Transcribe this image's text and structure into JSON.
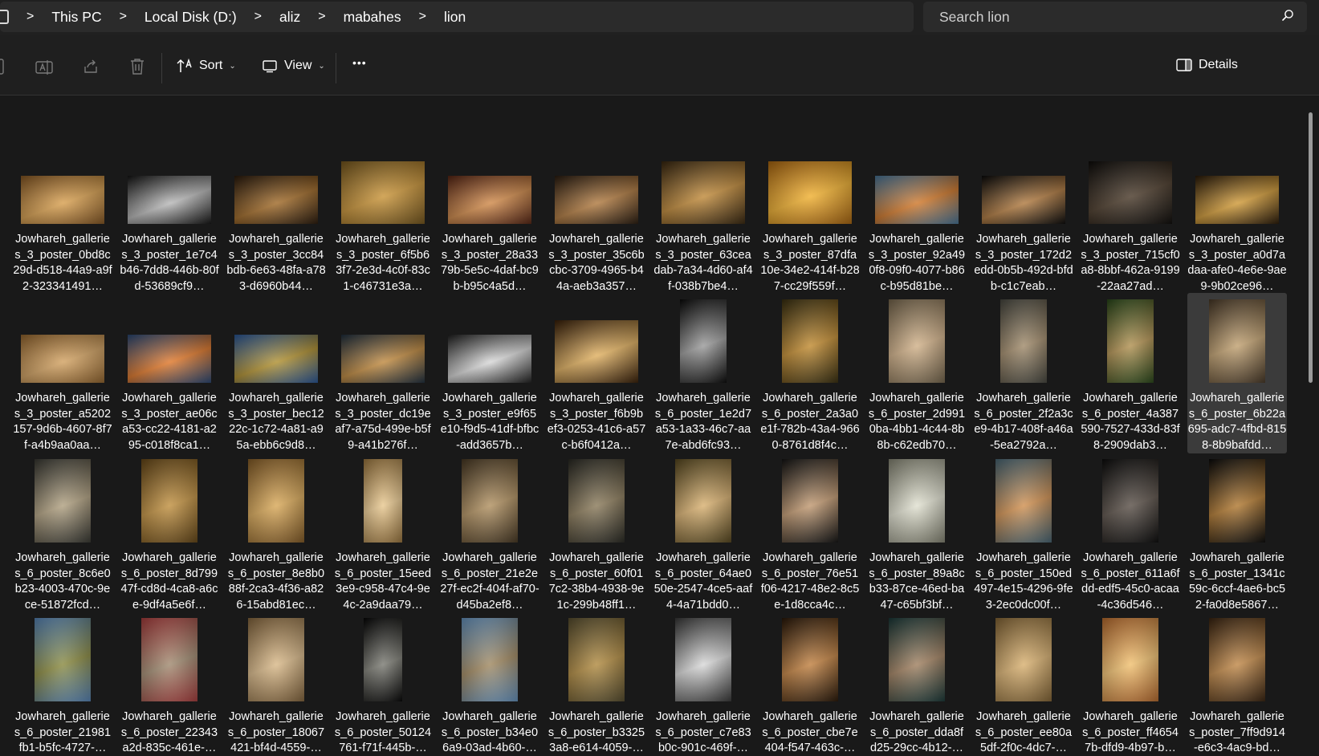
{
  "breadcrumb": {
    "items": [
      "This PC",
      "Local Disk (D:)",
      "aliz",
      "mabahes",
      "lion"
    ],
    "separator": ">"
  },
  "search": {
    "placeholder": "Search lion"
  },
  "toolbar": {
    "sort_label": "Sort",
    "view_label": "View",
    "more_label": "•••",
    "details_label": "Details"
  },
  "icons": [
    "pc-icon",
    "rename-icon",
    "share-icon",
    "delete-icon",
    "sort-icon",
    "view-icon",
    "details-pane-icon",
    "search-icon"
  ],
  "files": [
    {
      "name": "Jowhareh_galleries_3_poster_0bd8c29d-d518-44a9-a9f2-323341491…",
      "c1": "#8a5a24",
      "c2": "#d8a050",
      "selected": false
    },
    {
      "name": "Jowhareh_galleries_3_poster_1e7c4b46-7dd8-446b-80fd-53689cf9…",
      "c1": "#141414",
      "c2": "#b8b8b8",
      "selected": false
    },
    {
      "name": "Jowhareh_galleries_3_poster_3cc84bdb-6e63-48fa-a783-d6960b44…",
      "c1": "#2a1a0c",
      "c2": "#a06a28",
      "selected": false
    },
    {
      "name": "Jowhareh_galleries_3_poster_6f5b63f7-2e3d-4c0f-83c1-c46731e3a…",
      "c1": "#7a5a1e",
      "c2": "#c99438",
      "selected": false
    },
    {
      "name": "Jowhareh_galleries_3_poster_28a3379b-5e5c-4daf-bc9b-b95c4a5d…",
      "c1": "#5a2614",
      "c2": "#d08a4a",
      "selected": false
    },
    {
      "name": "Jowhareh_galleries_3_poster_35c6bcbc-3709-4965-b44a-aeb3a357…",
      "c1": "#2a1c10",
      "c2": "#b07a40",
      "selected": false
    },
    {
      "name": "Jowhareh_galleries_3_poster_63ceadab-7a34-4d60-af4f-038b7be4…",
      "c1": "#3a2810",
      "c2": "#c08a3a",
      "selected": false
    },
    {
      "name": "Jowhareh_galleries_3_poster_87dfa10e-34e2-414f-b287-cc29f559f…",
      "c1": "#b06a10",
      "c2": "#f0b030",
      "selected": false
    },
    {
      "name": "Jowhareh_galleries_3_poster_92a490f8-09f0-4077-b86c-b95d81be…",
      "c1": "#4a7aa0",
      "c2": "#d0782a",
      "selected": false
    },
    {
      "name": "Jowhareh_galleries_3_poster_172d2edd-0b5b-492d-bfdb-c1c7eab…",
      "c1": "#0a0a0a",
      "c2": "#b07a40",
      "selected": false
    },
    {
      "name": "Jowhareh_galleries_3_poster_715cf0a8-8bbf-462a-9199-22aa27ad…",
      "c1": "#0e0c0a",
      "c2": "#4a3a2a",
      "selected": false
    },
    {
      "name": "Jowhareh_galleries_3_poster_a0d7adaa-afe0-4e6e-9ae9-9b02ce96…",
      "c1": "#2a1a08",
      "c2": "#d09a38",
      "selected": false
    },
    {
      "name": "Jowhareh_galleries_3_poster_a5202157-9d6b-4607-8f7f-a4b9aa0aa…",
      "c1": "#9a6a30",
      "c2": "#d2a262",
      "selected": false
    },
    {
      "name": "Jowhareh_galleries_3_poster_ae06ca53-cc22-4181-a295-c018f8ca1…",
      "c1": "#2a4a7a",
      "c2": "#e0782a",
      "selected": false
    },
    {
      "name": "Jowhareh_galleries_3_poster_bec1222c-1c72-4a81-a95a-ebb6c9d8…",
      "c1": "#2a5aa0",
      "c2": "#b09030",
      "selected": false
    },
    {
      "name": "Jowhareh_galleries_3_poster_dc19eaf7-a75d-499e-b5f9-a41b276f…",
      "c1": "#203040",
      "c2": "#c08a40",
      "selected": false
    },
    {
      "name": "Jowhareh_galleries_3_poster_e9f65e10-f9d5-41df-bfbc-add3657b…",
      "c1": "#202020",
      "c2": "#d8d8d8",
      "selected": false
    },
    {
      "name": "Jowhareh_galleries_3_poster_f6b9bef3-0253-41c6-a57c-b6f0412a…",
      "c1": "#3a2008",
      "c2": "#e0b060",
      "selected": false
    },
    {
      "name": "Jowhareh_galleries_6_poster_1e2d7a53-1a33-46c7-aa7e-abd6fc93…",
      "c1": "#0a0a0a",
      "c2": "#9a9a9a",
      "selected": false
    },
    {
      "name": "Jowhareh_galleries_6_poster_2a3a0e1f-782b-43a4-9660-8761d8f4c…",
      "c1": "#3a3010",
      "c2": "#c08a30",
      "selected": false
    },
    {
      "name": "Jowhareh_galleries_6_poster_2d9910ba-4bb1-4c44-8b8b-c62edb70…",
      "c1": "#7a6a50",
      "c2": "#d0b088",
      "selected": false
    },
    {
      "name": "Jowhareh_galleries_6_poster_2f2a3ce9-4b17-408f-a46a-5ea2792a…",
      "c1": "#4a4a42",
      "c2": "#a08a6a",
      "selected": false
    },
    {
      "name": "Jowhareh_galleries_6_poster_4a387590-7527-433d-83f8-2909dab3…",
      "c1": "#2a4a1a",
      "c2": "#b09050",
      "selected": false
    },
    {
      "name": "Jowhareh_galleries_6_poster_6b22a695-adc7-4fbd-8158-8b9bafdd…",
      "c1": "#4a3a28",
      "c2": "#c0a070",
      "selected": true
    },
    {
      "name": "Jowhareh_galleries_6_poster_8c6e0b23-4003-470c-9ece-51872fcd…",
      "c1": "#3a3a34",
      "c2": "#b0a080",
      "selected": false
    },
    {
      "name": "Jowhareh_galleries_6_poster_8d79947f-cd8d-4ca8-a6ce-9df4a5e6f…",
      "c1": "#6a4a18",
      "c2": "#c09040",
      "selected": false
    },
    {
      "name": "Jowhareh_galleries_6_poster_8e8b088f-2ca3-4f36-a826-15abd81ec…",
      "c1": "#8a6028",
      "c2": "#d8a858",
      "selected": false
    },
    {
      "name": "Jowhareh_galleries_6_poster_15eed3e9-c958-47c4-9e4c-2a9daa79…",
      "c1": "#a07a40",
      "c2": "#e8c890",
      "selected": false
    },
    {
      "name": "Jowhareh_galleries_6_poster_21e2e27f-ec2f-404f-af70-d45ba2ef8…",
      "c1": "#4a3a24",
      "c2": "#b09060",
      "selected": false
    },
    {
      "name": "Jowhareh_galleries_6_poster_60f017c2-38b4-4938-9e1c-299b48ff1…",
      "c1": "#2a2a24",
      "c2": "#8a7a5a",
      "selected": false
    },
    {
      "name": "Jowhareh_galleries_6_poster_64ae050e-2547-4ce5-aaf4-4a71bdd0…",
      "c1": "#5a4a20",
      "c2": "#d8b070",
      "selected": false
    },
    {
      "name": "Jowhareh_galleries_6_poster_76e51f06-4217-48e2-8c5e-1d8cca4c…",
      "c1": "#141414",
      "c2": "#c09870",
      "selected": false
    },
    {
      "name": "Jowhareh_galleries_6_poster_89a8cb33-87ce-46ed-ba47-c65bf3bf…",
      "c1": "#8a8a78",
      "c2": "#e0e0d0",
      "selected": false
    },
    {
      "name": "Jowhareh_galleries_6_poster_150ed497-4e15-4296-9fe3-2ec0dc00f…",
      "c1": "#4a6a7a",
      "c2": "#d09050",
      "selected": false
    },
    {
      "name": "Jowhareh_galleries_6_poster_611a6fdd-edf5-45c0-acaa-4c36d546…",
      "c1": "#0c0c0c",
      "c2": "#5a5048",
      "selected": false
    },
    {
      "name": "Jowhareh_galleries_6_poster_1341c59c-6ccf-4ae6-bc52-fa0d8e5867…",
      "c1": "#0a0a0a",
      "c2": "#b07830",
      "selected": false
    },
    {
      "name": "Jowhareh_galleries_6_poster_21981fb1-b5fc-4727-…",
      "c1": "#5a8ac0",
      "c2": "#8a8a40",
      "selected": false
    },
    {
      "name": "Jowhareh_galleries_6_poster_22343a2d-835c-461e-…",
      "c1": "#b04040",
      "c2": "#a08a70",
      "selected": false
    },
    {
      "name": "Jowhareh_galleries_6_poster_18067421-bf4d-4559-…",
      "c1": "#8a6a40",
      "c2": "#d8b888",
      "selected": false
    },
    {
      "name": "Jowhareh_galleries_6_poster_50124761-f71f-445b-…",
      "c1": "#050505",
      "c2": "#7a7a72",
      "selected": false
    },
    {
      "name": "Jowhareh_galleries_6_poster_b34e06a9-03ad-4b60-…",
      "c1": "#6a9ac8",
      "c2": "#a08860",
      "selected": false
    },
    {
      "name": "Jowhareh_galleries_6_poster_b33253a8-e614-4059-…",
      "c1": "#5a5030",
      "c2": "#b08a40",
      "selected": false
    },
    {
      "name": "Jowhareh_galleries_6_poster_c7e83b0c-901c-469f-…",
      "c1": "#3a3a3a",
      "c2": "#d8d8d8",
      "selected": false
    },
    {
      "name": "Jowhareh_galleries_6_poster_cbe7e404-f547-463c-…",
      "c1": "#2a1808",
      "c2": "#c08040",
      "selected": false
    },
    {
      "name": "Jowhareh_galleries_6_poster_dda8fd25-29cc-4b12-…",
      "c1": "#1a3a3a",
      "c2": "#a08060",
      "selected": false
    },
    {
      "name": "Jowhareh_galleries_6_poster_ee80a5df-2f0c-4dc7-…",
      "c1": "#8a6a38",
      "c2": "#d8b070",
      "selected": false
    },
    {
      "name": "Jowhareh_galleries_6_poster_ff46547b-dfd9-4b97-b…",
      "c1": "#c07030",
      "c2": "#f0c070",
      "selected": false
    },
    {
      "name": "Jowhareh_galleries_poster_7ff9d914-e6c3-4ac9-bd…",
      "c1": "#3a2410",
      "c2": "#c08848",
      "selected": false
    }
  ],
  "colors": {
    "background": "#191919",
    "chrome": "#202020",
    "selected_tile": "#3b3b3b",
    "text": "#ffffff"
  }
}
